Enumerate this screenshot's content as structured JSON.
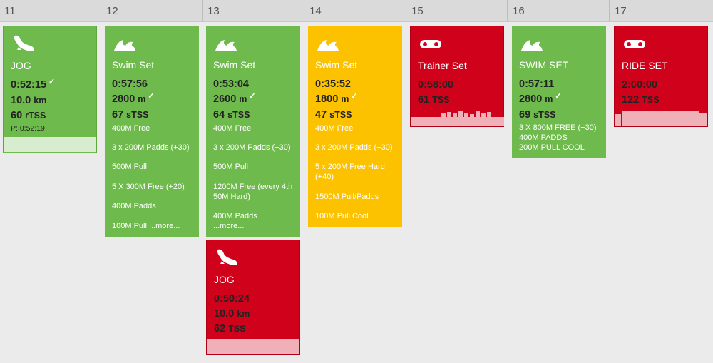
{
  "days": [
    "11",
    "12",
    "13",
    "14",
    "15",
    "16",
    "17"
  ],
  "workouts": [
    {
      "id": "jog-11",
      "icon": "shoe",
      "title": "JOG",
      "duration": "0:52:15",
      "duration_check": "✓",
      "distance": "10.0",
      "distance_unit": "km",
      "tss": "60",
      "tss_unit": "rTSS",
      "planned": "P: 0:52:19",
      "color": "#6fba4c"
    },
    {
      "id": "swim-12",
      "icon": "wave",
      "title": "Swim Set",
      "duration": "0:57:56",
      "distance": "2800",
      "distance_unit": "m",
      "distance_check": "✓",
      "tss": "67",
      "tss_unit": "sTSS",
      "lines": [
        "400M Free",
        "3 x 200M Padds (+30)",
        "500M Pull",
        "5 X 300M Free (+20)",
        "400M Padds",
        "100M Pull ...more..."
      ],
      "color": "#6fba4c"
    },
    {
      "id": "swim-13",
      "icon": "wave",
      "title": "Swim Set",
      "duration": "0:53:04",
      "distance": "2600",
      "distance_unit": "m",
      "distance_check": "✓",
      "tss": "64",
      "tss_unit": "sTSS",
      "lines": [
        "400M Free",
        "3 x 200M Padds (+30)",
        "500M Pull",
        "1200M Free (every 4th 50M Hard)",
        "400M Padds\n...more..."
      ],
      "color": "#6fba4c"
    },
    {
      "id": "jog-13",
      "icon": "shoe",
      "title": "JOG",
      "duration": "0:50:24",
      "distance": "10.0",
      "distance_unit": "km",
      "tss": "62",
      "tss_unit": "TSS",
      "color": "#d0021b"
    },
    {
      "id": "swim-14",
      "icon": "wave",
      "title": "Swim Set",
      "duration": "0:35:52",
      "distance": "1800",
      "distance_unit": "m",
      "distance_check": "✓",
      "tss": "47",
      "tss_unit": "sTSS",
      "lines": [
        "400M Free",
        "3 x 200M Padds (+30)",
        "5 x 200M Free Hard (+40)",
        "1500M Pull/Padds",
        "100M Pull Cool"
      ],
      "color": "#fcc200"
    },
    {
      "id": "trainer-15",
      "icon": "chain",
      "title": "Trainer Set",
      "duration": "0:58:00",
      "tss": "61",
      "tss_unit": "TSS",
      "color": "#d0021b"
    },
    {
      "id": "swim-16",
      "icon": "wave",
      "title": "SWIM SET",
      "duration": "0:57:11",
      "distance": "2800",
      "distance_unit": "m",
      "distance_check": "✓",
      "tss": "69",
      "tss_unit": "sTSS",
      "lines": [
        "3 X 800M FREE (+30)\n400M PADDS\n200M PULL COOL"
      ],
      "color": "#6fba4c"
    },
    {
      "id": "ride-17",
      "icon": "chain",
      "title": "RIDE SET",
      "duration": "2:00:00",
      "tss": "122",
      "tss_unit": "TSS",
      "color": "#d0021b"
    }
  ]
}
